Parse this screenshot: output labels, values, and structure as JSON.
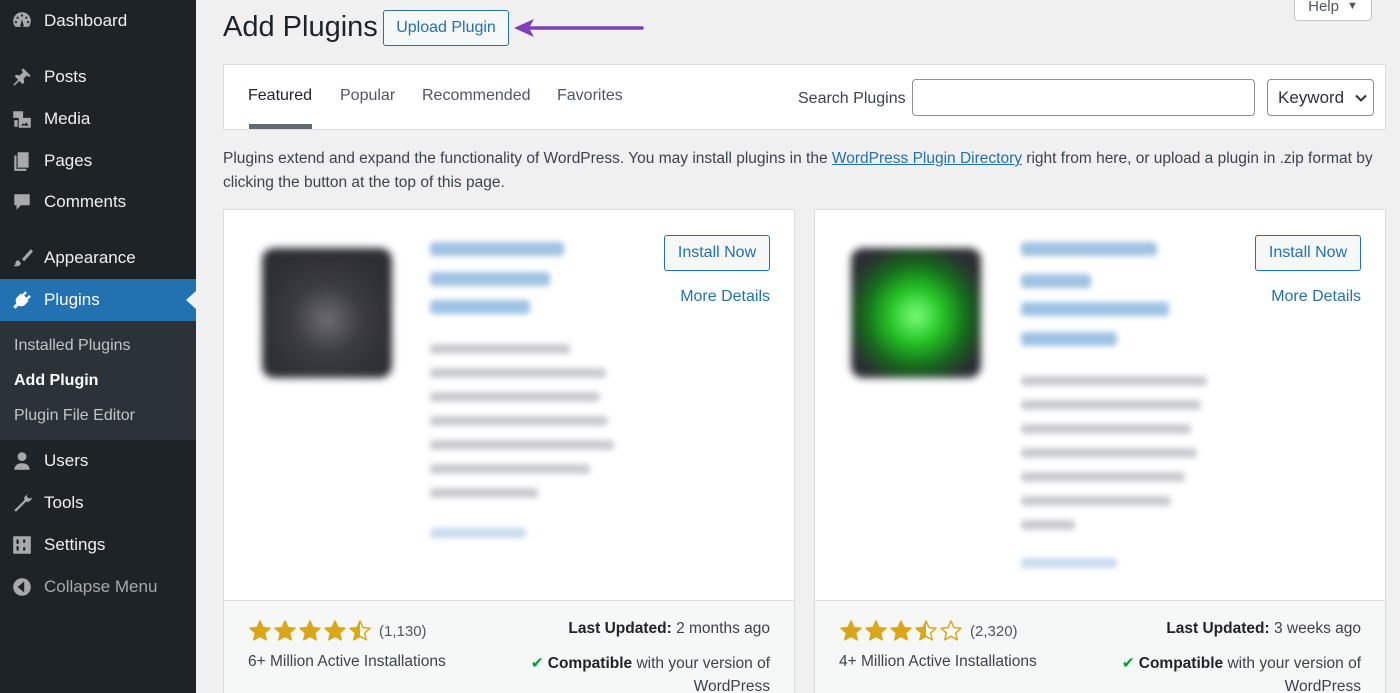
{
  "sidebar": {
    "items": [
      {
        "label": "Dashboard",
        "icon": "dashboard-icon"
      },
      {
        "label": "Posts",
        "icon": "pin-icon"
      },
      {
        "label": "Media",
        "icon": "media-icon"
      },
      {
        "label": "Pages",
        "icon": "pages-icon"
      },
      {
        "label": "Comments",
        "icon": "comment-icon"
      },
      {
        "label": "Appearance",
        "icon": "brush-icon"
      },
      {
        "label": "Plugins",
        "icon": "plug-icon"
      },
      {
        "label": "Users",
        "icon": "user-icon"
      },
      {
        "label": "Tools",
        "icon": "wrench-icon"
      },
      {
        "label": "Settings",
        "icon": "sliders-icon"
      },
      {
        "label": "Collapse Menu",
        "icon": "collapse-icon"
      }
    ],
    "submenu": [
      "Installed Plugins",
      "Add Plugin",
      "Plugin File Editor"
    ]
  },
  "header": {
    "title": "Add Plugins",
    "upload_label": "Upload Plugin",
    "help_label": "Help"
  },
  "filter": {
    "tabs": [
      "Featured",
      "Popular",
      "Recommended",
      "Favorites"
    ],
    "search_label": "Search Plugins",
    "search_value": "",
    "keyword_label": "Keyword"
  },
  "intro": {
    "part1": "Plugins extend and expand the functionality of WordPress. You may install plugins in the ",
    "link": "WordPress Plugin Directory",
    "part2": " right from here, or upload a plugin in .zip format by clicking the button at the top of this page."
  },
  "cards": [
    {
      "install_label": "Install Now",
      "details_label": "More Details",
      "rating": 4.5,
      "rating_count": "(1,130)",
      "installs": "6+ Million Active Installations",
      "updated_label": "Last Updated:",
      "updated_value": "2 months ago",
      "compat_label": "Compatible",
      "compat_text": "with your version of WordPress"
    },
    {
      "install_label": "Install Now",
      "details_label": "More Details",
      "rating": 3.5,
      "rating_count": "(2,320)",
      "installs": "4+ Million Active Installations",
      "updated_label": "Last Updated:",
      "updated_value": "3 weeks ago",
      "compat_label": "Compatible",
      "compat_text": "with your version of WordPress"
    }
  ],
  "colors": {
    "sidebar_bg": "#1d2327",
    "accent": "#2271b1",
    "star": "#dba617",
    "compatible": "#00a32a",
    "annotation_arrow": "#7e3fbc"
  }
}
